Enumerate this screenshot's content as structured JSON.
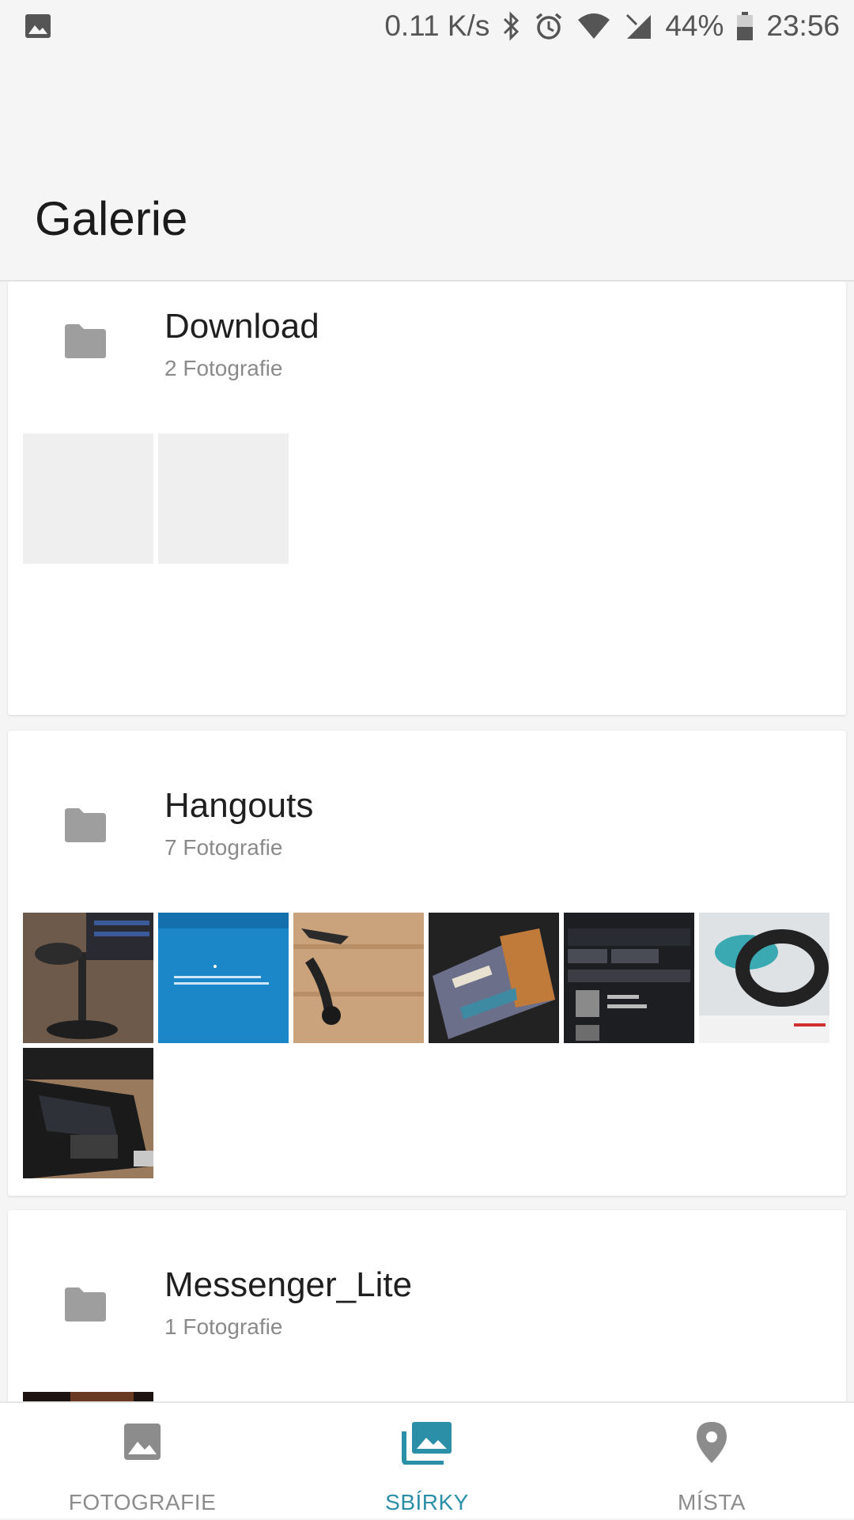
{
  "status_bar": {
    "net_speed": "0.11 K/s",
    "battery": "44%",
    "time": "23:56"
  },
  "app_bar": {
    "title": "Galerie"
  },
  "albums": [
    {
      "name": "Download",
      "count": "2 Fotografie"
    },
    {
      "name": "Hangouts",
      "count": "7 Fotografie"
    },
    {
      "name": "Messenger_Lite",
      "count": "1 Fotografie"
    }
  ],
  "bottom_nav": {
    "items": [
      {
        "label": "FOTOGRAFIE",
        "icon": "photo-icon",
        "active": false
      },
      {
        "label": "SBÍRKY",
        "icon": "collections-icon",
        "active": true
      },
      {
        "label": "MÍSTA",
        "icon": "place-pin-icon",
        "active": false
      }
    ]
  },
  "colors": {
    "accent": "#2b8fa8",
    "inactive": "#8c8c8c",
    "background": "#f5f5f5"
  }
}
